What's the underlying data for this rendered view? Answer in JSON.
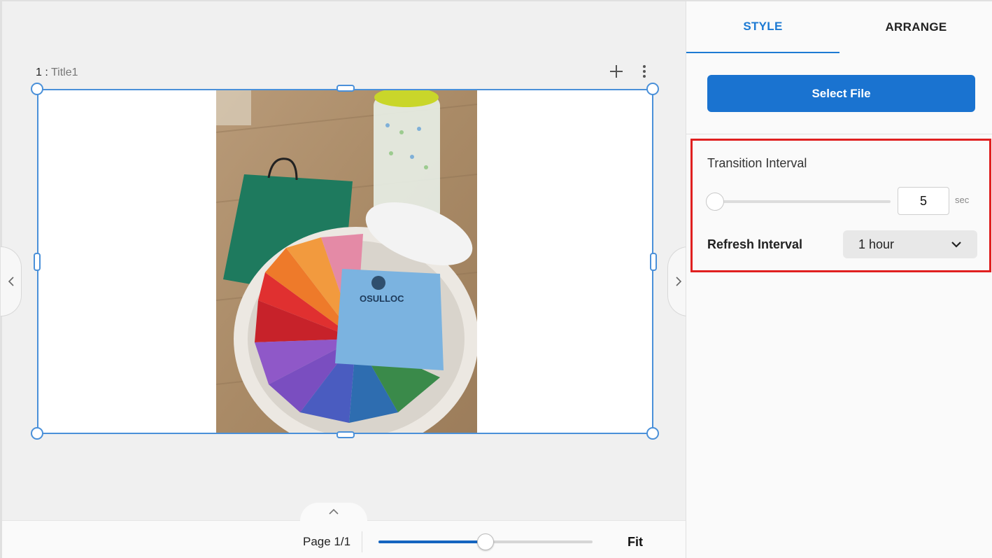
{
  "canvas": {
    "slide_number": "1 :",
    "slide_title": "Title1",
    "page_label": "Page 1/1",
    "zoom_fit_label": "Fit",
    "zoom_level": 0.5,
    "photo_description_icon": "tea-box-photo"
  },
  "panel": {
    "tabs": [
      {
        "label": "STYLE",
        "active": true
      },
      {
        "label": "ARRANGE",
        "active": false
      }
    ],
    "select_file_label": "Select File",
    "transition_interval": {
      "label": "Transition Interval",
      "value": "5",
      "unit": "sec",
      "slider_fraction": 0
    },
    "refresh_interval": {
      "label": "Refresh Interval",
      "selected": "1 hour"
    }
  },
  "colors": {
    "accent": "#1d7ad3",
    "button": "#1a73d0",
    "selection": "#4a90d9",
    "highlight": "#e02020"
  }
}
